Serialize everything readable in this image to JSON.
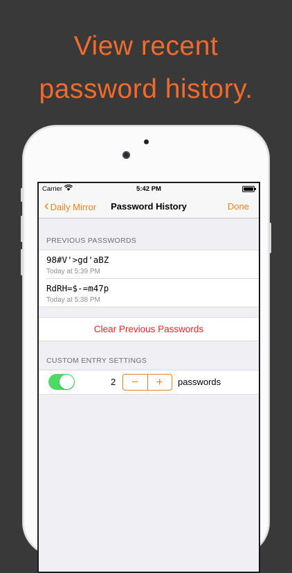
{
  "headline": {
    "line1": "View recent",
    "line2": "password history."
  },
  "status_bar": {
    "carrier": "Carrier",
    "time": "5:42 PM"
  },
  "navbar": {
    "back_label": "Daily Mirror",
    "title": "Password History",
    "done_label": "Done"
  },
  "previous_passwords": {
    "header": "PREVIOUS PASSWORDS",
    "items": [
      {
        "password": "98#V'>gd'aBZ",
        "time": "Today at 5:39 PM"
      },
      {
        "password": "RdRH=$-=m47p",
        "time": "Today at 5:38 PM"
      }
    ]
  },
  "clear_button": "Clear Previous Passwords",
  "custom_entry": {
    "header": "CUSTOM ENTRY SETTINGS",
    "toggle_on": true,
    "count": "2",
    "minus": "−",
    "plus": "+",
    "unit": "passwords"
  },
  "colors": {
    "accent": "#f07f20",
    "headline": "#f26b2d",
    "destructive": "#e0282d",
    "toggle": "#4cd964"
  }
}
